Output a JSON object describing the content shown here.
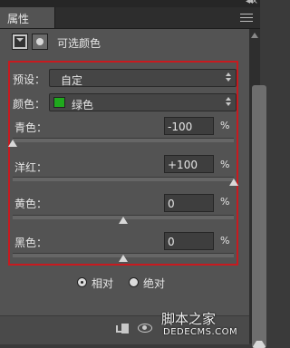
{
  "panel": {
    "tab_label": "属性"
  },
  "adjustment": {
    "title": "可选颜色"
  },
  "preset": {
    "label": "预设：",
    "value": "自定"
  },
  "colors": {
    "label": "颜色：",
    "value": "绿色",
    "swatch": "#1fa81d"
  },
  "sliders": [
    {
      "label": "青色：",
      "value": "-100",
      "unit": "%",
      "level": -100
    },
    {
      "label": "洋红：",
      "value": "+100",
      "unit": "%",
      "level": 100
    },
    {
      "label": "黄色：",
      "value": "0",
      "unit": "%",
      "level": 0
    },
    {
      "label": "黑色：",
      "value": "0",
      "unit": "%",
      "level": 0
    }
  ],
  "method": {
    "relative_label": "相对",
    "absolute_label": "绝对",
    "selected": "relative"
  },
  "watermark": {
    "line1": "脚本之家",
    "line2": "DEDECMS.COM"
  },
  "icons": {
    "mask": "mask-icon",
    "layer": "layer-icon",
    "panel_menu": "panel-menu-icon",
    "clip": "clip-to-layer-icon",
    "visibility": "eye-icon"
  }
}
